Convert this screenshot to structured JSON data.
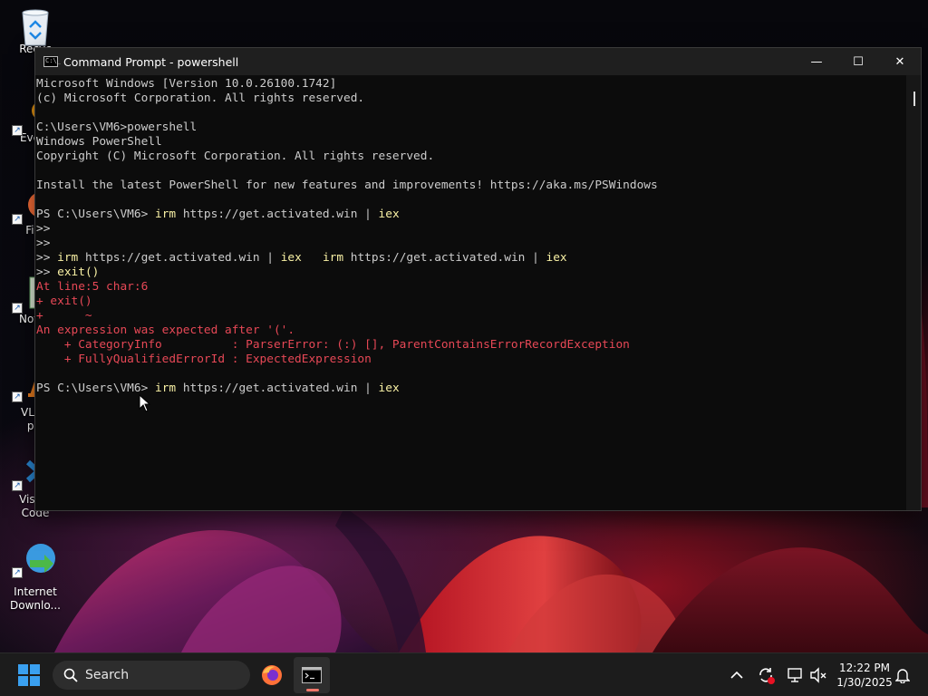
{
  "desktop": {
    "icons": [
      {
        "label": "Recyc"
      },
      {
        "label": "Every"
      },
      {
        "label": "Fire"
      },
      {
        "label": "Notep"
      },
      {
        "label": "VLC r",
        "label2": "pla"
      },
      {
        "label": "Visual",
        "label2": "Code"
      },
      {
        "label": "Internet",
        "label2": "Downlo..."
      }
    ]
  },
  "window": {
    "title": "Command Prompt - powershell",
    "minimize_glyph": "—",
    "maximize_glyph": "☐",
    "close_glyph": "✕"
  },
  "console": {
    "lines": [
      {
        "segs": [
          {
            "t": "Microsoft Windows [Version 10.0.26100.1742]",
            "c": "gray"
          }
        ]
      },
      {
        "segs": [
          {
            "t": "(c) Microsoft Corporation. All rights reserved.",
            "c": "gray"
          }
        ]
      },
      {
        "segs": [
          {
            "t": "",
            "c": "gray"
          }
        ]
      },
      {
        "segs": [
          {
            "t": "C:\\Users\\VM6>powershell",
            "c": "gray"
          }
        ]
      },
      {
        "segs": [
          {
            "t": "Windows PowerShell",
            "c": "gray"
          }
        ]
      },
      {
        "segs": [
          {
            "t": "Copyright (C) Microsoft Corporation. All rights reserved.",
            "c": "gray"
          }
        ]
      },
      {
        "segs": [
          {
            "t": "",
            "c": "gray"
          }
        ]
      },
      {
        "segs": [
          {
            "t": "Install the latest PowerShell for new features and improvements! https://aka.ms/PSWindows",
            "c": "gray"
          }
        ]
      },
      {
        "segs": [
          {
            "t": "",
            "c": "gray"
          }
        ]
      },
      {
        "segs": [
          {
            "t": "PS C:\\Users\\VM6> ",
            "c": "gray"
          },
          {
            "t": "irm",
            "c": "yellow"
          },
          {
            "t": " https://get.activated.win | ",
            "c": "gray"
          },
          {
            "t": "iex",
            "c": "yellow"
          }
        ]
      },
      {
        "segs": [
          {
            "t": ">>",
            "c": "gray"
          }
        ]
      },
      {
        "segs": [
          {
            "t": ">>",
            "c": "gray"
          }
        ]
      },
      {
        "segs": [
          {
            "t": ">> ",
            "c": "gray"
          },
          {
            "t": "irm",
            "c": "yellow"
          },
          {
            "t": " https://get.activated.win | ",
            "c": "gray"
          },
          {
            "t": "iex",
            "c": "yellow"
          },
          {
            "t": "   ",
            "c": "gray"
          },
          {
            "t": "irm",
            "c": "yellow"
          },
          {
            "t": " https://get.activated.win | ",
            "c": "gray"
          },
          {
            "t": "iex",
            "c": "yellow"
          }
        ]
      },
      {
        "segs": [
          {
            "t": ">> ",
            "c": "gray"
          },
          {
            "t": "exit()",
            "c": "yellow"
          }
        ]
      },
      {
        "segs": [
          {
            "t": "At line:5 char:6",
            "c": "red"
          }
        ]
      },
      {
        "segs": [
          {
            "t": "+ exit()",
            "c": "red"
          }
        ]
      },
      {
        "segs": [
          {
            "t": "+      ~",
            "c": "red"
          }
        ]
      },
      {
        "segs": [
          {
            "t": "An expression was expected after '('.",
            "c": "red"
          }
        ]
      },
      {
        "segs": [
          {
            "t": "    + CategoryInfo          : ParserError: (:) [], ParentContainsErrorRecordException",
            "c": "red"
          }
        ]
      },
      {
        "segs": [
          {
            "t": "    + FullyQualifiedErrorId : ExpectedExpression",
            "c": "red"
          }
        ]
      },
      {
        "segs": [
          {
            "t": "",
            "c": "gray"
          }
        ]
      },
      {
        "segs": [
          {
            "t": "PS C:\\Users\\VM6> ",
            "c": "gray"
          },
          {
            "t": "irm",
            "c": "yellow"
          },
          {
            "t": " https://get.activated.win | ",
            "c": "gray"
          },
          {
            "t": "iex",
            "c": "yellow"
          }
        ]
      }
    ]
  },
  "taskbar": {
    "search_label": "Search",
    "clock_time": "12:22 PM",
    "clock_date": "1/30/2025"
  },
  "colors": {
    "console_bg": "#0c0c0c",
    "console_text": "#cccccc",
    "console_yellow": "#f9f1a5",
    "console_red": "#e74856",
    "taskbar_bg": "#1c1c1c"
  }
}
